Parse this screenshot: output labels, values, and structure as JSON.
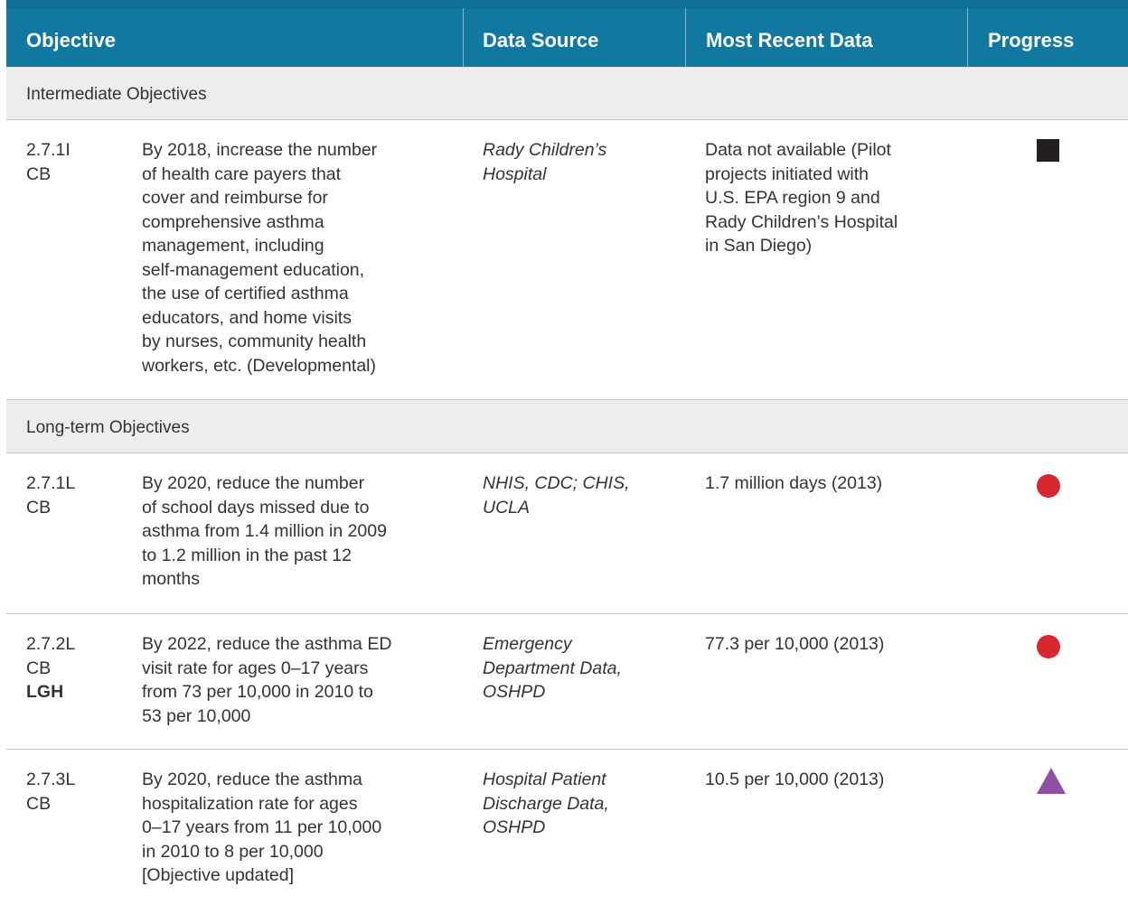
{
  "header": {
    "objective": "Objective",
    "data_source": "Data Source",
    "most_recent_data": "Most Recent Data",
    "progress": "Progress"
  },
  "sections": [
    {
      "title": "Intermediate Objectives",
      "rows": [
        {
          "id_lines": [
            "2.7.1I",
            "CB"
          ],
          "text_lines": [
            "By 2018, increase the number",
            "of health care payers that",
            "cover and reimburse for",
            "comprehensive asthma",
            "management, including",
            "self-management education,",
            "the use of certified asthma",
            "educators, and home visits",
            "by nurses, community health",
            "workers, etc. (Developmental)"
          ],
          "source_lines": [
            "Rady Children’s",
            "Hospital"
          ],
          "recent_lines": [
            "Data not available (Pilot",
            "projects initiated with",
            "U.S. EPA region 9 and",
            "Rady Children’s Hospital",
            "in San Diego)"
          ],
          "progress_icon": "black-square-icon",
          "progress_color": "#231f20"
        }
      ]
    },
    {
      "title": "Long-term Objectives",
      "rows": [
        {
          "id_lines": [
            "2.7.1L",
            "CB"
          ],
          "text_lines": [
            "By 2020, reduce the number",
            "of school days missed due to",
            "asthma from 1.4 million in 2009",
            "to 1.2 million in the past 12",
            "months"
          ],
          "source_lines": [
            "NHIS, CDC; CHIS,",
            "UCLA"
          ],
          "recent_lines": [
            "1.7 million days (2013)"
          ],
          "progress_icon": "red-circle-icon",
          "progress_color": "#d7282f"
        },
        {
          "id_lines": [
            "2.7.2L",
            "CB",
            "LGH"
          ],
          "text_lines": [
            "By 2022, reduce the asthma ED",
            "visit rate for ages 0–17 years",
            "from 73 per 10,000 in 2010 to",
            "53 per 10,000"
          ],
          "source_lines": [
            "Emergency",
            "Department Data,",
            "OSHPD"
          ],
          "recent_lines": [
            "77.3 per 10,000 (2013)"
          ],
          "progress_icon": "red-circle-icon",
          "progress_color": "#d7282f"
        },
        {
          "id_lines": [
            "2.7.3L",
            "CB"
          ],
          "text_lines": [
            "By 2020, reduce the asthma",
            "hospitalization rate for ages",
            "0–17 years from 11 per 10,000",
            "in 2010 to 8 per 10,000",
            "[Objective updated]"
          ],
          "source_lines": [
            "Hospital Patient",
            "Discharge Data,",
            "OSHPD"
          ],
          "recent_lines": [
            "10.5 per 10,000 (2013)"
          ],
          "progress_icon": "purple-triangle-icon",
          "progress_color": "#8f4fa3"
        }
      ]
    }
  ]
}
